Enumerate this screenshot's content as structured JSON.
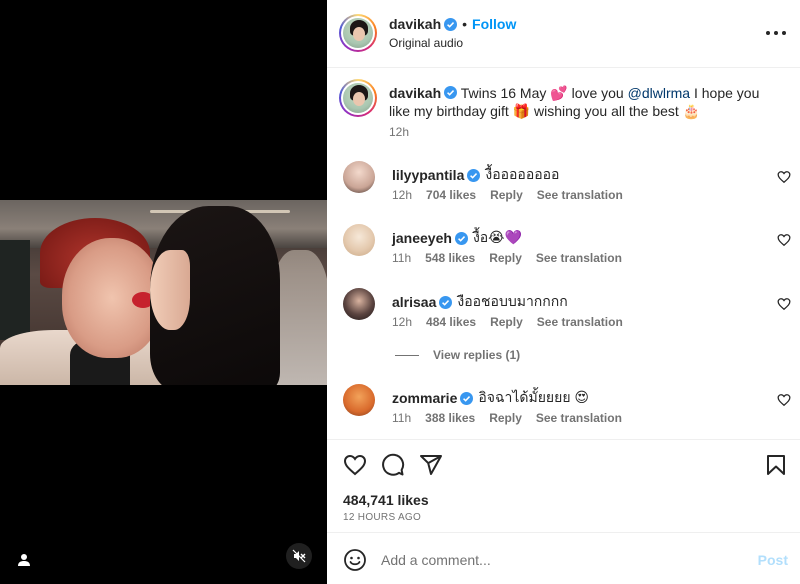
{
  "post": {
    "username": "davikah",
    "follow_label": "Follow",
    "audio_label": "Original audio",
    "caption_pre": "Twins 16 May 💕 love you ",
    "caption_mention": "@dlwlrma",
    "caption_post": " I hope you like my birthday gift 🎁 wishing you all the best 🎂",
    "caption_time": "12h"
  },
  "comments": [
    {
      "username": "lilyypantila",
      "text": "งื้ออออออออ",
      "time": "12h",
      "likes": "704 likes",
      "reply": "Reply",
      "translate": "See translation"
    },
    {
      "username": "janeeyeh",
      "text": "งื้อ😭💜",
      "time": "11h",
      "likes": "548 likes",
      "reply": "Reply",
      "translate": "See translation"
    },
    {
      "username": "alrisaa",
      "text": "งืออชอบบมากกกก",
      "time": "12h",
      "likes": "484 likes",
      "reply": "Reply",
      "translate": "See translation"
    },
    {
      "username": "zommarie",
      "text": "อิจฉาได้มั้ยยยย 😍",
      "time": "11h",
      "likes": "388 likes",
      "reply": "Reply",
      "translate": "See translation"
    }
  ],
  "view_replies": "View replies (1)",
  "stats": {
    "likes": "484,741 likes",
    "ago": "12 HOURS AGO"
  },
  "composer": {
    "placeholder": "Add a comment...",
    "post_label": "Post"
  },
  "icons": [
    "user-tag-icon",
    "mute-icon",
    "more-icon",
    "verified-icon",
    "heart-icon",
    "comment-icon",
    "share-icon",
    "bookmark-icon",
    "emoji-icon"
  ],
  "colors": {
    "accent": "#0095f6",
    "verified": "#3897f0",
    "post_disabled": "#b2dffc"
  }
}
